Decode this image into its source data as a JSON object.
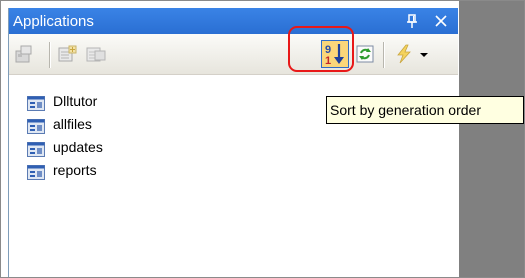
{
  "panel": {
    "title": "Applications",
    "pin_glyph": "ᵠ",
    "close_glyph": "✕"
  },
  "toolbar": {
    "buttons": [
      {
        "name": "properties-button",
        "icon": "properties-icon",
        "enabled": false
      },
      {
        "name": "add-application-button",
        "icon": "add-application-icon",
        "enabled": false
      },
      {
        "name": "remove-application-button",
        "icon": "remove-application-icon",
        "enabled": false
      },
      {
        "name": "sort-by-generation-order-button",
        "icon": "sort-numeric-icon",
        "enabled": true,
        "active": true
      },
      {
        "name": "refresh-button",
        "icon": "refresh-icon",
        "enabled": true
      },
      {
        "name": "generate-button",
        "icon": "lightning-icon",
        "enabled": false
      },
      {
        "name": "dropdown-button",
        "icon": "dropdown-arrow-icon",
        "enabled": true
      }
    ],
    "sort_icon_top": "9",
    "sort_icon_bottom": "1"
  },
  "applications": [
    {
      "label": "Dlltutor",
      "icon": "application-icon"
    },
    {
      "label": "allfiles",
      "icon": "application-icon"
    },
    {
      "label": "updates",
      "icon": "application-icon"
    },
    {
      "label": "reports",
      "icon": "application-icon"
    }
  ],
  "tooltip": {
    "text": "Sort by generation order"
  },
  "colors": {
    "titlebar": "#2a6fd3",
    "highlight_ring": "#e81818",
    "tooltip_bg": "#ffffe1",
    "active_button": "#fbd67a",
    "side_area": "#808080"
  }
}
